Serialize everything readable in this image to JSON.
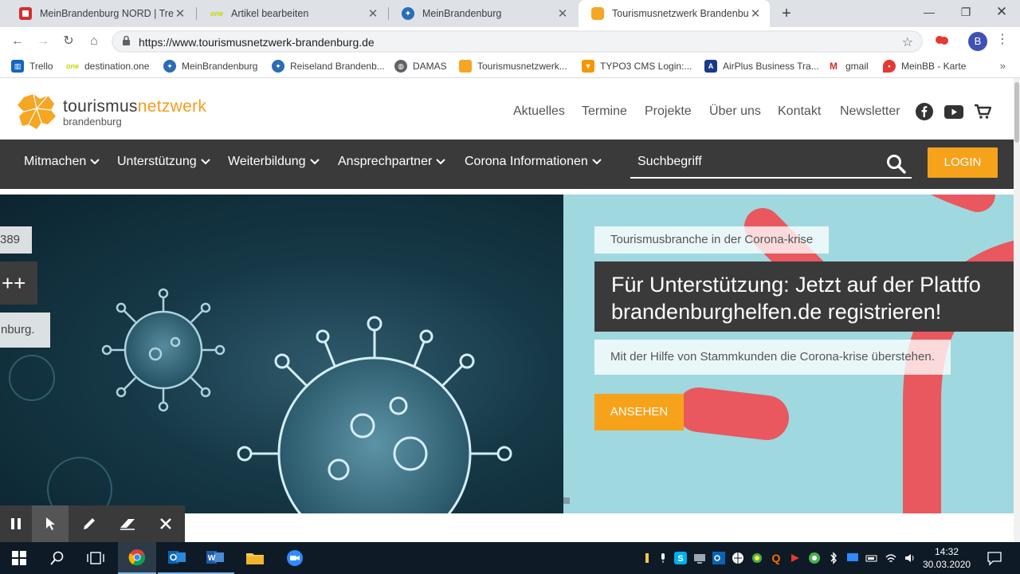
{
  "browser": {
    "tabs": [
      {
        "title": "MeinBrandenburg NORD | Trello",
        "favicon": "trello-icon",
        "active": false
      },
      {
        "title": "Artikel bearbeiten",
        "favicon": "destination-one-icon",
        "active": false
      },
      {
        "title": "MeinBrandenburg",
        "favicon": "meinbrandenburg-icon",
        "active": false
      },
      {
        "title": "Tourismusnetzwerk Brandenburg",
        "favicon": "tourismusnetzwerk-icon",
        "active": true
      }
    ],
    "url": "https://www.tourismusnetzwerk-brandenburg.de",
    "profile_initial": "B",
    "bookmarks": [
      {
        "label": "Trello",
        "icon": "trello-icon"
      },
      {
        "label": "destination.one",
        "icon": "destination-one-icon"
      },
      {
        "label": "MeinBrandenburg",
        "icon": "meinbrandenburg-icon"
      },
      {
        "label": "Reiseland Brandenb...",
        "icon": "reiseland-icon"
      },
      {
        "label": "DAMAS",
        "icon": "globe-icon"
      },
      {
        "label": "Tourismusnetzwerk...",
        "icon": "tourismusnetzwerk-icon"
      },
      {
        "label": "TYPO3 CMS Login:...",
        "icon": "typo3-icon"
      },
      {
        "label": "AirPlus Business Tra...",
        "icon": "airplus-icon"
      },
      {
        "label": "gmail",
        "icon": "gmail-icon"
      },
      {
        "label": "MeinBB - Karte",
        "icon": "map-pin-icon"
      }
    ],
    "bookmarks_more": "»"
  },
  "site": {
    "logo": {
      "word1": "tourismus",
      "word2": "netzwerk",
      "sub": "brandenburg"
    },
    "topnav": [
      "Aktuelles",
      "Termine",
      "Projekte",
      "Über uns",
      "Kontakt",
      "Newsletter"
    ],
    "mainnav": [
      "Mitmachen",
      "Unterstützung",
      "Weiterbildung",
      "Ansprechpartner",
      "Corona Informationen"
    ],
    "search_placeholder": "Suchbegriff",
    "login_label": "LOGIN",
    "hero_left_fragments": {
      "top": "389",
      "mid": "++",
      "bottom": "nburg."
    },
    "hero": {
      "chip": "Tourismusbranche in der Corona-krise",
      "title_line1": "Für Unterstützung: Jetzt auf der Plattfo",
      "title_line2": "brandenburghelfen.de registrieren!",
      "description": "Mit der Hilfe von Stammkunden die Corona-krise überstehen.",
      "button": "ANSEHEN"
    },
    "slides_count": 3,
    "active_slide": 1
  },
  "taskbar": {
    "time": "14:32",
    "date": "30.03.2020"
  },
  "colors": {
    "brand_orange": "#f7a21b",
    "nav_dark": "#3a3a3a",
    "hero_teal": "#a0d8df",
    "hero_pink": "#e8585e"
  }
}
